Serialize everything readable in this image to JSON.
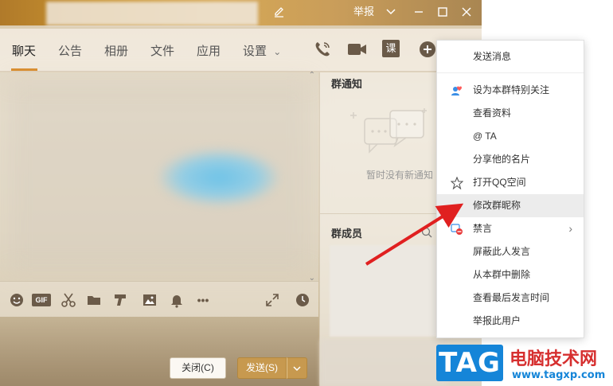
{
  "titlebar": {
    "report_label": "举报",
    "edit_icon": "pencil-icon",
    "dropdown_icon": "chevron-down-icon",
    "minimize_icon": "minimize-icon",
    "maximize_icon": "maximize-icon",
    "close_icon": "close-icon"
  },
  "tabs": [
    {
      "label": "聊天",
      "active": true
    },
    {
      "label": "公告",
      "active": false
    },
    {
      "label": "相册",
      "active": false
    },
    {
      "label": "文件",
      "active": false
    },
    {
      "label": "应用",
      "active": false
    },
    {
      "label": "设置",
      "active": false
    }
  ],
  "tab_accent": "#d98c2b",
  "toolbar_icons": [
    "phone-icon",
    "video-call-icon",
    "lesson-icon",
    "add-icon"
  ],
  "toolbar_lesson_glyph": "课",
  "input_toolbar_icons": [
    "emoji-icon",
    "gif-icon",
    "scissors-icon",
    "folder-icon",
    "tencent-doc-icon",
    "image-icon",
    "bell-icon",
    "more-icon",
    "expand-icon",
    "history-clock-icon"
  ],
  "gif_label": "GIF",
  "side": {
    "notice_title": "群通知",
    "notice_empty": "暂时没有新通知",
    "members_title": "群成员"
  },
  "buttons": {
    "close_label": "关闭(C)",
    "send_label": "发送(S)",
    "send_arrow": "⌄"
  },
  "menu": {
    "items": [
      {
        "label": "发送消息",
        "icon": ""
      },
      {
        "label": "设为本群特别关注",
        "icon": "special-care-icon"
      },
      {
        "label": "查看资料",
        "icon": ""
      },
      {
        "label": "@ TA",
        "icon": ""
      },
      {
        "label": "分享他的名片",
        "icon": ""
      },
      {
        "label": "打开QQ空间",
        "icon": "qzone-star-icon"
      },
      {
        "label": "修改群昵称",
        "icon": ""
      },
      {
        "label": "禁言",
        "icon": "mute-icon",
        "submenu": "›"
      },
      {
        "label": "屏蔽此人发言",
        "icon": ""
      },
      {
        "label": "从本群中删除",
        "icon": ""
      },
      {
        "label": "查看最后发言时间",
        "icon": ""
      },
      {
        "label": "举报此用户",
        "icon": ""
      }
    ]
  },
  "annotation": {
    "color": "#e02020"
  },
  "watermark": {
    "tag": "TAG",
    "title": "电脑技术网",
    "url": "www.tagxp.com"
  }
}
